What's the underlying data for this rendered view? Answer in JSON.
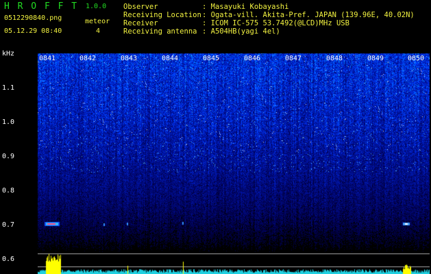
{
  "app": {
    "title": "H R O F F T",
    "version": "1.0.0",
    "filename": "0512290840.png",
    "datetime": "05.12.29 08:40",
    "counter_label": "meteor",
    "counter_value": "4"
  },
  "info": {
    "observer_label": "Observer",
    "observer_value": ": Masayuki Kobayashi",
    "location_label": "Receiving Location",
    "location_value": ": Ogata-vill. Akita-Pref. JAPAN (139.96E, 40.02N)",
    "receiver_label": "Receiver",
    "receiver_value": ": ICOM IC-575 53.7492(@LCD)MHz USB",
    "antenna_label": "Receiving antenna",
    "antenna_value": ": A504HB(yagi 4el)"
  },
  "axis": {
    "unit": "kHz",
    "y_ticks": [
      "1.1",
      "1.0",
      "0.9",
      "0.8",
      "0.7",
      "0.6"
    ],
    "time_labels": [
      "0841",
      "0842",
      "0843",
      "0844",
      "0845",
      "0846",
      "0847",
      "0848",
      "0849",
      "0850"
    ]
  },
  "colors": {
    "green": "#22dd22",
    "yellow": "#f2f240",
    "spectrum_blue": "#1a2fd0",
    "panel_cyan": "#20d0e0",
    "panel_yellow": "#ffff00"
  }
}
